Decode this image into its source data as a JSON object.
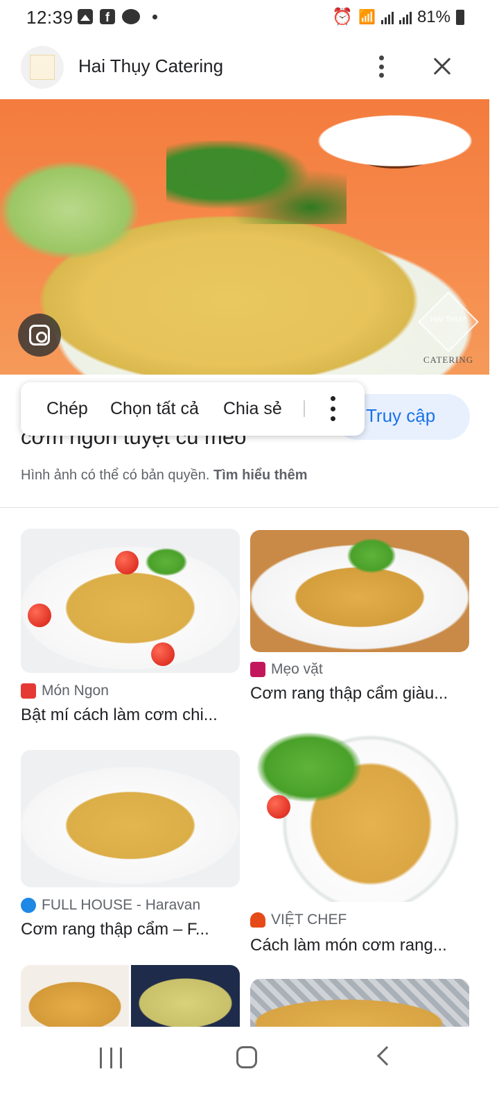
{
  "status_bar": {
    "time": "12:39",
    "battery": "81%",
    "icons": [
      "gallery-icon",
      "facebook-icon",
      "messenger-icon",
      "alarm-icon",
      "wifi-icon",
      "signal-icon",
      "signal-icon",
      "battery-icon"
    ]
  },
  "header": {
    "site_name": "Hai Thụy Catering",
    "more_icon": "more-vert-icon",
    "close_icon": "close-icon"
  },
  "hero": {
    "logo_text": "HAI THUY",
    "logo_caption": "CATERING"
  },
  "context_menu": {
    "items": [
      "Chép",
      "Chọn tất cả",
      "Chia sẻ"
    ],
    "more_icon": "more-vert-icon"
  },
  "visit_button": {
    "label": "Truy cập"
  },
  "image_title": "cơm ngon tuyệt cú mèo",
  "copyright": {
    "text": "Hình ảnh có thể có bản quyền.",
    "link": "Tìm hiểu thêm"
  },
  "results": [
    {
      "source": "Món Ngon",
      "title": "Bật mí cách làm cơm chi...",
      "source_color": "#e53935"
    },
    {
      "source": "Mẹo vặt",
      "title": "Cơm rang thập cẩm giàu...",
      "source_color": "#c2185b"
    },
    {
      "source": "FULL HOUSE - Haravan",
      "title": "Cơm rang thập cẩm – F...",
      "source_color": "#1e88e5"
    },
    {
      "source": "VIỆT CHEF",
      "title": "Cách làm món cơm rang...",
      "source_color": "#e64a19"
    }
  ],
  "colors": {
    "accent": "#1a73e8",
    "visit_bg": "#e8f0fe"
  }
}
